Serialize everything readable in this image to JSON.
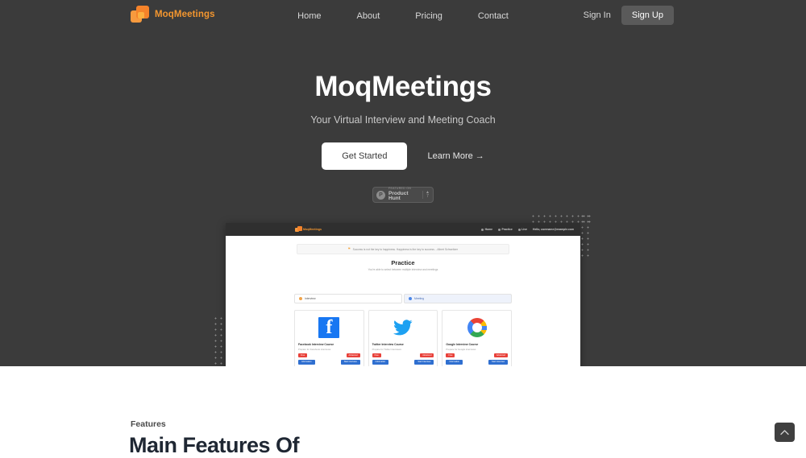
{
  "navbar": {
    "brand": "MoqMeetings",
    "links": [
      {
        "label": "Home"
      },
      {
        "label": "About"
      },
      {
        "label": "Pricing"
      },
      {
        "label": "Contact"
      }
    ],
    "sign_in": "Sign In",
    "sign_up": "Sign Up"
  },
  "hero": {
    "title": "MoqMeetings",
    "subtitle": "Your Virtual Interview and Meeting Coach",
    "primary_cta": "Get Started",
    "secondary_cta": "Learn More →",
    "product_hunt": {
      "kicker": "FEATURED ON",
      "name": "Product Hunt",
      "arrow": "▲",
      "count": "7"
    }
  },
  "app_preview": {
    "brand": "MoqMeetings",
    "nav_items": [
      {
        "label": "Home"
      },
      {
        "label": "Practice"
      },
      {
        "label": "Live"
      },
      {
        "label": "Hello, username@example.com"
      }
    ],
    "quote_mark": "❝",
    "quote": "Success is not the key to happiness. Happiness is the key to success. - Albert Schweitzer",
    "heading": "Practice",
    "subheading": "You're able to select between multiple interview and meetings",
    "tabs": [
      {
        "label": "Interview"
      },
      {
        "label": "Meeting"
      }
    ],
    "cards": [
      {
        "logo": "facebook-logo",
        "glyph": "f",
        "title": "Facebook Interview Course",
        "desc": "Prepare for Facebook interviews",
        "badge_left": "Free",
        "badge_right": "Advanced",
        "btn_left": "Information",
        "btn_right": "Start Interview"
      },
      {
        "logo": "twitter-logo",
        "glyph": "🐦",
        "title": "Twitter Interview Course",
        "desc": "Prepare for Twitter interviews",
        "badge_left": "Free",
        "badge_right": "Advanced",
        "btn_left": "Information",
        "btn_right": "Start Interview"
      },
      {
        "logo": "google-logo",
        "glyph": "G",
        "title": "Google Interview Course",
        "desc": "Prepare for Google interviews",
        "badge_left": "Free",
        "badge_right": "Advanced",
        "btn_left": "Information",
        "btn_right": "Start Interview"
      }
    ]
  },
  "features": {
    "kicker": "Features",
    "title": "Main Features Of"
  },
  "scroll_top": {
    "icon": "chevron-up-icon"
  },
  "colors": {
    "hero_bg": "#3b3b3b",
    "brand_orange": "#f3962f",
    "accent_blue": "#2f6fd0",
    "badge_red": "#e8413a"
  }
}
